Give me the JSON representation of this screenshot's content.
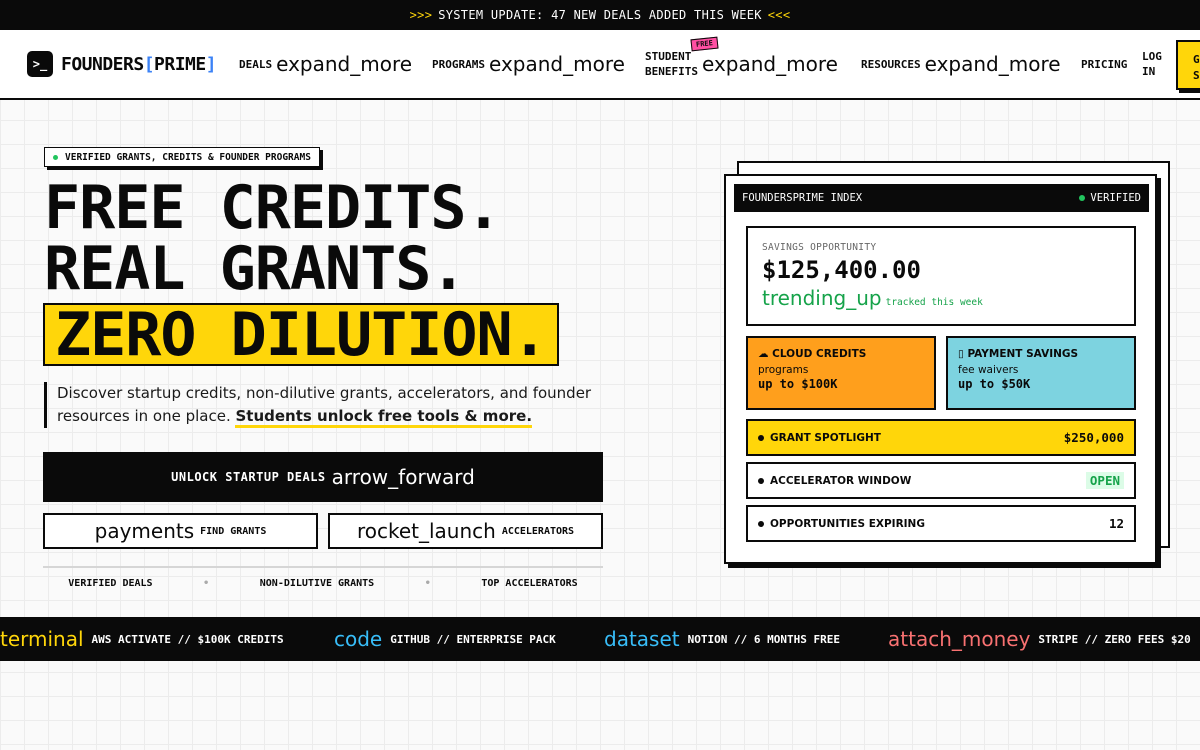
{
  "announcement": {
    "arrows_left": ">>>",
    "text": "SYSTEM UPDATE: 47 NEW DEALS ADDED THIS WEEK",
    "arrows_right": "<<<"
  },
  "nav": {
    "logo_mark": ">_",
    "logo_word": "FOUNDERS",
    "logo_bracket_open": "[",
    "logo_highlight": "PRIME",
    "logo_bracket_close": "]",
    "items": [
      {
        "label": "DEALS",
        "icon": "expand_more"
      },
      {
        "label": "PROGRAMS",
        "icon": "expand_more"
      },
      {
        "label_line1": "STUDENT",
        "label_line2": "BENEFITS",
        "icon": "expand_more",
        "badge": "FREE"
      },
      {
        "label": "RESOURCES",
        "icon": "expand_more"
      },
      {
        "label": "PRICING"
      }
    ],
    "login_line1": "LOG",
    "login_line2": "IN",
    "cta_line1": "G",
    "cta_line2": "S"
  },
  "hero": {
    "chip": "VERIFIED GRANTS, CREDITS & FOUNDER PROGRAMS",
    "line1": "FREE CREDITS.",
    "line2": "REAL GRANTS.",
    "line3": "ZERO DILUTION.",
    "description": "Discover startup credits, non-dilutive grants, accelerators, and founder resources in one place. ",
    "description_strong": "Students unlock free tools & more.",
    "primary_button": {
      "label": "UNLOCK STARTUP DEALS",
      "icon": "arrow_forward"
    },
    "secondary_buttons": [
      {
        "icon": "payments",
        "label": "FIND GRANTS"
      },
      {
        "icon": "rocket_launch",
        "label": "ACCELERATORS"
      }
    ],
    "trust": [
      "VERIFIED DEALS",
      "NON-DILUTIVE GRANTS",
      "TOP ACCELERATORS"
    ],
    "trust_sep": "•"
  },
  "card": {
    "header_title": "FOUNDERSPRIME INDEX",
    "header_status": "VERIFIED",
    "savings_label": "SAVINGS OPPORTUNITY",
    "savings_amount": "$125,400.00",
    "trend_icon": "trending_up",
    "trend_text": "tracked this week",
    "tiles": [
      {
        "icon": "☁",
        "title": "CLOUD CREDITS",
        "sub": "programs",
        "value": "up to $100K",
        "color": "#ff9f1c"
      },
      {
        "icon": "▯",
        "title": "PAYMENT SAVINGS",
        "sub": "fee waivers",
        "value": "up to $50K",
        "color": "#7dd3e0"
      }
    ],
    "rows": [
      {
        "label": "GRANT SPOTLIGHT",
        "value": "$250,000"
      },
      {
        "label": "ACCELERATOR WINDOW",
        "value": "OPEN"
      },
      {
        "label": "OPPORTUNITIES EXPIRING",
        "value": "12"
      }
    ],
    "spotlight_color": "#ffd60a"
  },
  "ticker": [
    {
      "icon": "terminal",
      "text": "AWS ACTIVATE // $100K CREDITS",
      "color": "#ffd60a"
    },
    {
      "icon": "code",
      "text": "GITHUB // ENTERPRISE PACK",
      "color": "#38bdf8"
    },
    {
      "icon": "dataset",
      "text": "NOTION // 6 MONTHS FREE",
      "color": "#38bdf8"
    },
    {
      "icon": "attach_money",
      "text": "STRIPE // ZERO FEES $20",
      "color": "#f87171"
    }
  ]
}
